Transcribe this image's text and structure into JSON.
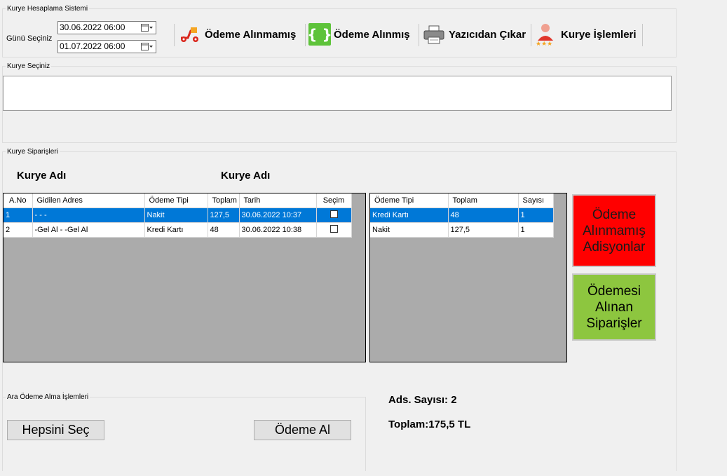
{
  "header_group": {
    "title": "Kurye Hesaplama Sistemi",
    "date_label": "Günü Seçiniz",
    "date_start": "30.06.2022 06:00",
    "date_end": "01.07.2022 06:00"
  },
  "toolbar": {
    "unpaid_label": "Ödeme Alınmamış",
    "paid_label": "Ödeme Alınmış",
    "print_label": "Yazıcıdan Çıkar",
    "courier_ops_label": "Kurye İşlemleri"
  },
  "courier_select_group": {
    "title": "Kurye Seçiniz"
  },
  "orders_group": {
    "title": "Kurye Siparişleri",
    "courier_name_left": "Kurye Adı",
    "courier_name_right": "Kurye Adı"
  },
  "orders_table": {
    "columns": [
      "A.No",
      "Gidilen Adres",
      "Ödeme Tipi",
      "Toplam",
      "Tarih",
      "Seçim"
    ],
    "rows": [
      {
        "no": "1",
        "address": "- - -",
        "payment": "Nakit",
        "total": "127,5",
        "date": "30.06.2022 10:37",
        "selected": false
      },
      {
        "no": "2",
        "address": "-Gel Al - -Gel Al",
        "payment": "Kredi Kartı",
        "total": "48",
        "date": "30.06.2022 10:38",
        "selected": false
      }
    ]
  },
  "summary_table": {
    "columns": [
      "Ödeme Tipi",
      "Toplam",
      "Sayısı"
    ],
    "rows": [
      {
        "payment": "Kredi Kartı",
        "total": "48",
        "count": "1"
      },
      {
        "payment": "Nakit",
        "total": "127,5",
        "count": "1"
      }
    ]
  },
  "side_buttons": {
    "unpaid_orders_line1": "Ödeme",
    "unpaid_orders_line2": "Alınmamış",
    "unpaid_orders_line3": "Adisyonlar",
    "paid_orders_line1": "Ödemesi",
    "paid_orders_line2": "Alınan",
    "paid_orders_line3": "Siparişler"
  },
  "partial_payment_group": {
    "title": "Ara Ödeme Alma İşlemleri",
    "select_all_label": "Hepsini Seç",
    "take_payment_label": "Ödeme Al"
  },
  "totals": {
    "ads_count": "Ads. Sayısı: 2",
    "total": "Toplam:175,5 TL"
  },
  "colors": {
    "selection": "#0078d7",
    "unpaid_button": "#ff0000",
    "paid_button": "#8dc63f",
    "panel_background": "#ababab"
  }
}
